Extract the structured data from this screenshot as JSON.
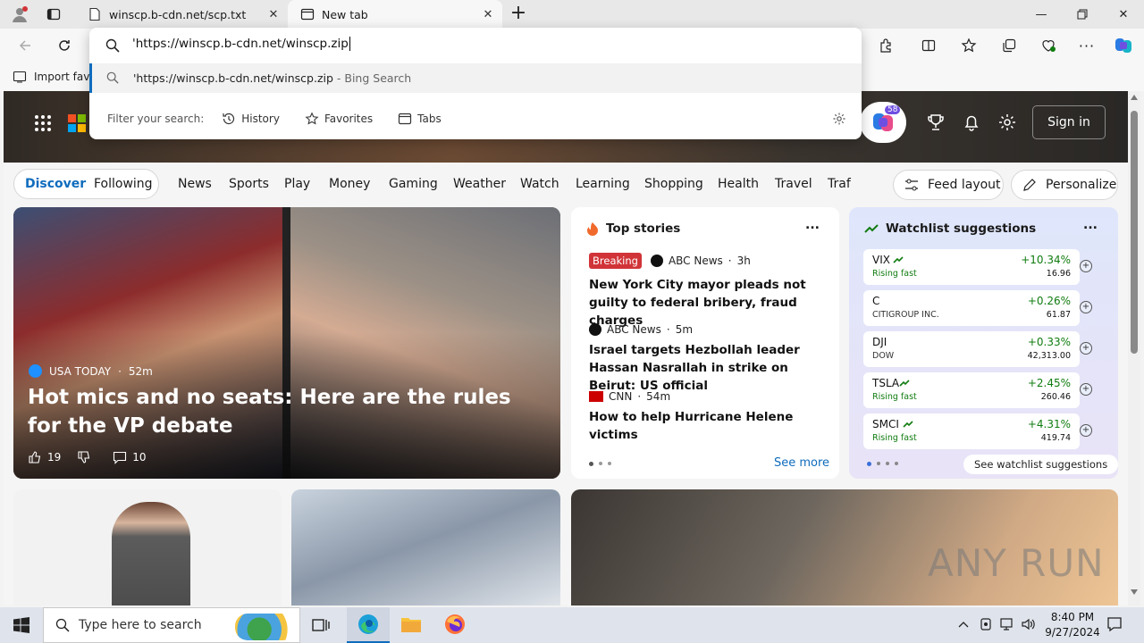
{
  "browser": {
    "tabs": [
      {
        "title": "winscp.b-cdn.net/scp.txt",
        "active": false
      },
      {
        "title": "New tab",
        "active": true
      }
    ],
    "new_tab_symbol": "+",
    "favorites_bar": {
      "import_label": "Import favo"
    }
  },
  "omnibox": {
    "typed_text": "'https://winscp.b-cdn.net/winscp.zip",
    "suggestion": {
      "text": "'https://winscp.b-cdn.net/winscp.zip",
      "suffix": " - Bing Search"
    },
    "filter_label": "Filter your search:",
    "filters": [
      "History",
      "Favorites",
      "Tabs"
    ]
  },
  "newtab": {
    "signin_label": "Sign in",
    "copilot_badge": "58",
    "feed_toggle": [
      "Discover",
      "Following"
    ],
    "nav_items": [
      "News",
      "Sports",
      "Play",
      "Money",
      "Gaming",
      "Weather",
      "Watch",
      "Learning",
      "Shopping",
      "Health",
      "Travel",
      "Traf"
    ],
    "feed_layout_label": "Feed layout",
    "personalize_label": "Personalize",
    "hero": {
      "source": "USA TODAY",
      "age": "52m",
      "headline": "Hot mics and no seats: Here are the rules for the VP debate",
      "likes": "19",
      "comments": "10"
    },
    "top_stories": {
      "title": "Top stories",
      "more": "...",
      "items": [
        {
          "badge": "Breaking",
          "source": "ABC News",
          "age": "3h",
          "headline": "New York City mayor pleads not guilty to federal bribery, fraud charges"
        },
        {
          "badge": "",
          "source": "ABC News",
          "age": "5m",
          "headline": "Israel targets Hezbollah leader Hassan Nasrallah in strike on Beirut: US official"
        },
        {
          "badge": "",
          "source": "CNN",
          "age": "54m",
          "headline": "How to help Hurricane Helene victims"
        }
      ],
      "see_more": "See more"
    },
    "watchlist": {
      "title": "Watchlist suggestions",
      "more": "...",
      "rows": [
        {
          "symbol": "VIX",
          "sub": "Rising fast",
          "change": "+10.34%",
          "price": "16.96",
          "rising": true
        },
        {
          "symbol": "C",
          "sub": "CITIGROUP INC.",
          "change": "+0.26%",
          "price": "61.87",
          "rising": false
        },
        {
          "symbol": "DJI",
          "sub": "DOW",
          "change": "+0.33%",
          "price": "42,313.00",
          "rising": false
        },
        {
          "symbol": "TSLA",
          "sub": "Rising fast",
          "change": "+2.45%",
          "price": "260.46",
          "rising": true
        },
        {
          "symbol": "SMCI",
          "sub": "Rising fast",
          "change": "+4.31%",
          "price": "419.74",
          "rising": true
        }
      ],
      "see_label": "See watchlist suggestions"
    }
  },
  "watermark": "ANY RUN",
  "taskbar": {
    "search_placeholder": "Type here to search",
    "time": "8:40 PM",
    "date": "9/27/2024"
  },
  "colors": {
    "accent": "#0f6cbd",
    "breaking": "#d13438",
    "up": "#107c10"
  }
}
